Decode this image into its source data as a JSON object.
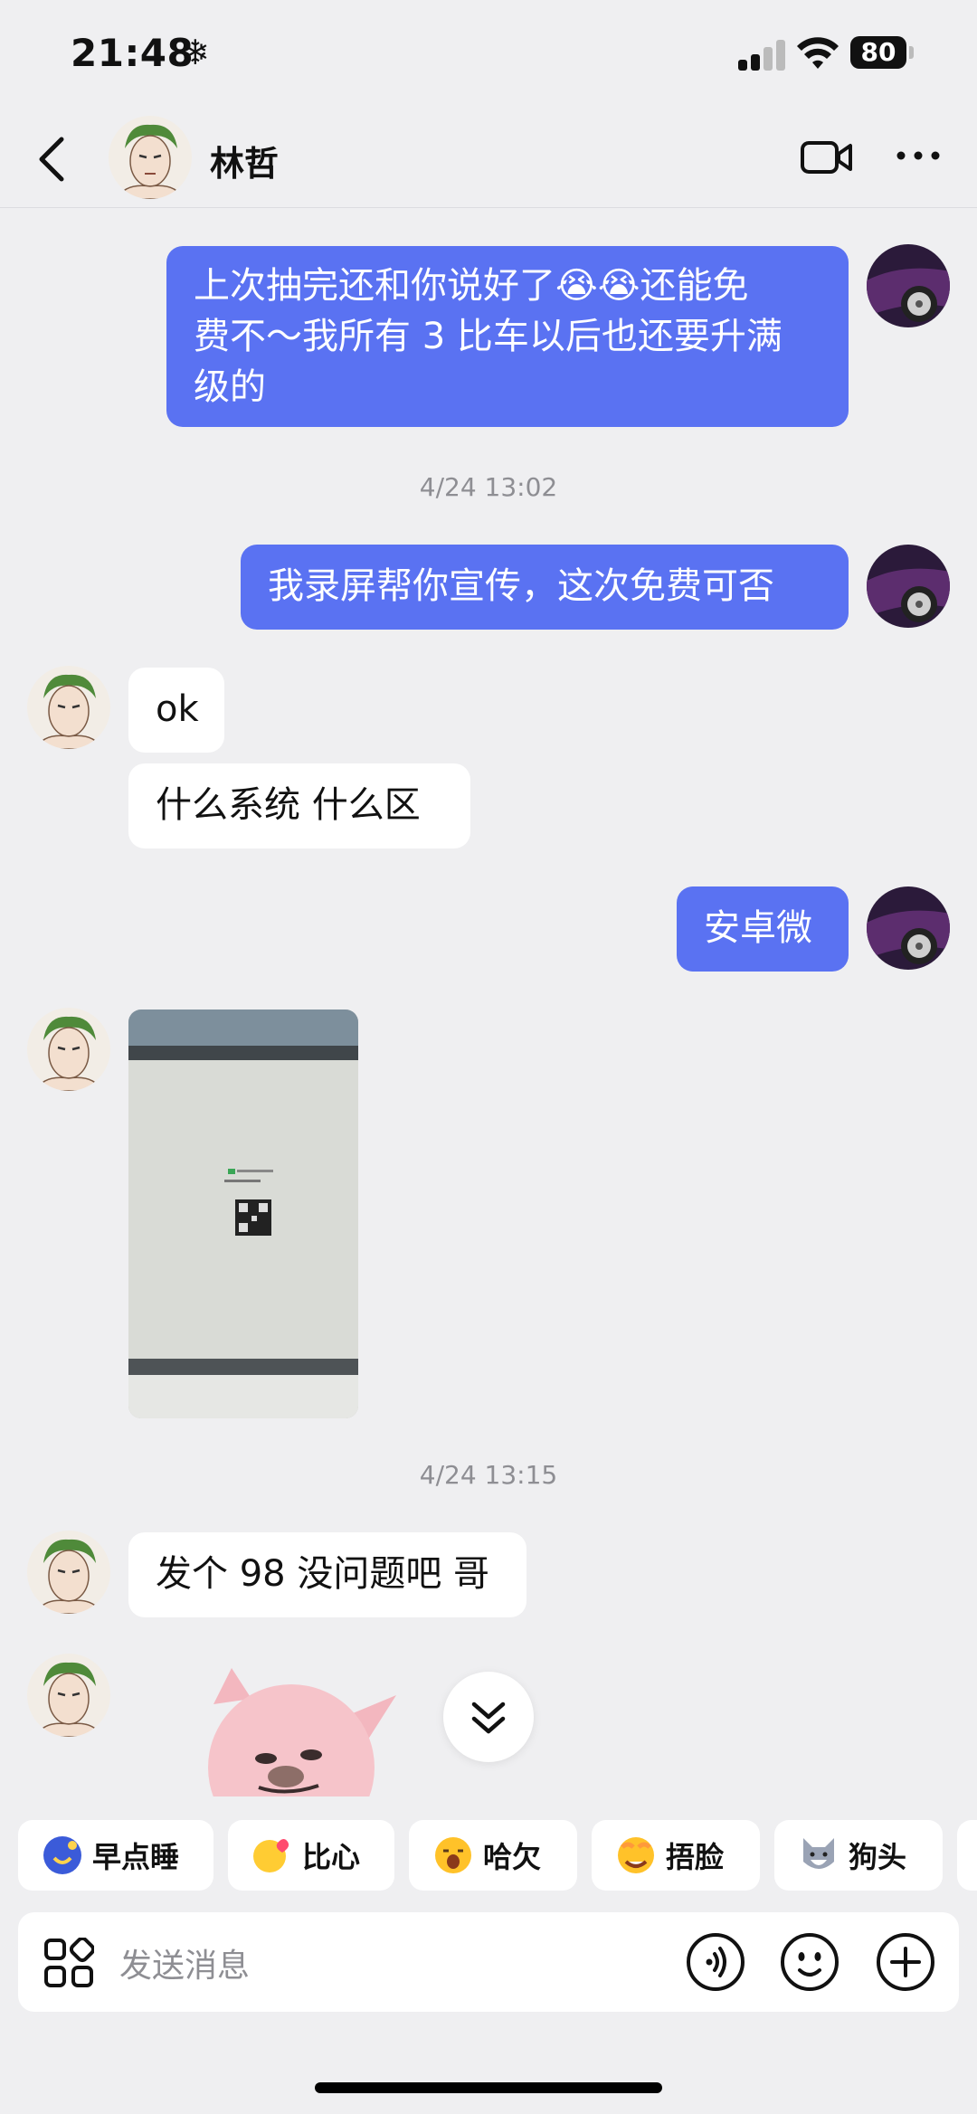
{
  "status": {
    "time": "21:48",
    "battery": "80"
  },
  "header": {
    "contact_name": "林哲"
  },
  "messages": {
    "m1": "上次抽完还和你说好了😭😭还能免费不～我所有3比车以后也还要升满级的",
    "m1_line1": "上次抽完还和你说好了",
    "m1_line1_tail": "还能免",
    "m1_line2": "费不～我所有 3 比车以后也还要升满",
    "m1_line3": "级的",
    "ts1": "4/24 13:02",
    "m2": "我录屏帮你宣传，这次免费可否",
    "m3": "ok",
    "m4": "什么系统 什么区",
    "m5": "安卓微",
    "ts2": "4/24 13:15",
    "m6": "发个 98 没问题吧 哥"
  },
  "quick_replies": [
    {
      "label": "早点睡",
      "icon": "moon-sleep-icon"
    },
    {
      "label": "比心",
      "icon": "heart-hands-icon"
    },
    {
      "label": "哈欠",
      "icon": "yawn-icon"
    },
    {
      "label": "捂脸",
      "icon": "facepalm-icon"
    },
    {
      "label": "狗头",
      "icon": "dog-head-icon"
    }
  ],
  "input": {
    "placeholder": "发送消息"
  },
  "colors": {
    "my_bubble": "#5a72f2",
    "background": "#efeff1"
  }
}
